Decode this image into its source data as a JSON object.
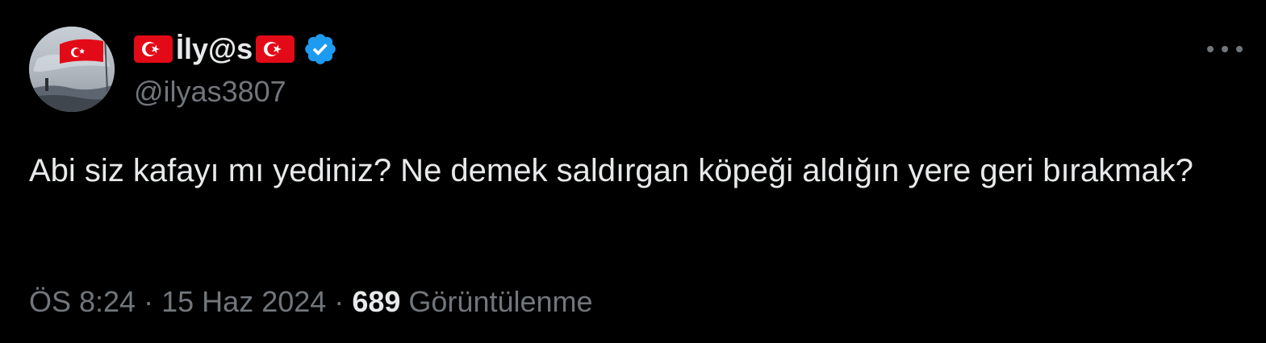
{
  "author": {
    "display_name": "İly@s",
    "handle": "@ilyas3807",
    "verified": true,
    "flag_icon": "turkey-flag-icon",
    "verified_color": "#1d9bf0"
  },
  "tweet": {
    "text": "Abi siz kafayı mı yediniz? Ne demek saldırgan köpeği aldığın yere geri bırakmak?"
  },
  "meta": {
    "time": "ÖS 8:24",
    "separator": "·",
    "date": "15 Haz 2024",
    "views_count": "689",
    "views_label": "Görüntülenme"
  },
  "colors": {
    "background": "#000000",
    "primary_text": "#e7e9ea",
    "secondary_text": "#71767b",
    "flag_red": "#e30a17"
  }
}
